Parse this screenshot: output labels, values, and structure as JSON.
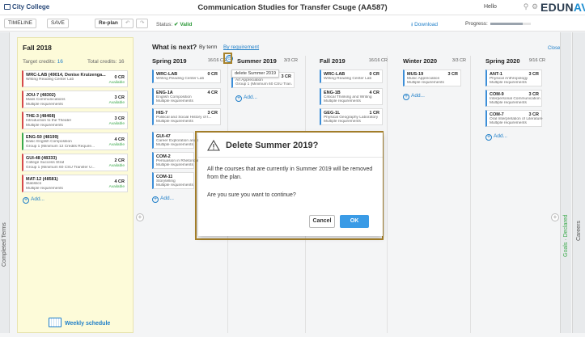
{
  "app": {
    "logo": "City College",
    "title": "Communication Studies for Transfer Csuge (AA587)",
    "hello": "Hello",
    "brand_main": "EDUN",
    "brand_accent": "AV"
  },
  "toolbar": {
    "timeline": "TIMELINE",
    "save": "SAVE",
    "replan": "Re-plan",
    "undo": "↶",
    "redo": "↷",
    "status_label": "Status:",
    "status_value": "Valid",
    "download": "Download",
    "progress_label": "Progress:",
    "progress_value": 0.8
  },
  "sidebars": {
    "completed_terms": "Completed Terms",
    "goals": "Goals · Declared",
    "careers": "Careers"
  },
  "fall": {
    "title": "Fall 2018",
    "target_label": "Target credits:",
    "target_value": "16",
    "total_label": "Total credits:",
    "total_value": "16",
    "courses": [
      {
        "code": "WRC-LAB (49014, Denise Kruizenga...",
        "desc1": "Writing Reading Center Lab",
        "desc2": "",
        "cr": "0 CR",
        "avail": "Available"
      },
      {
        "code": "JOU-7 (48302)",
        "desc1": "Mass Communications",
        "desc2": "Multiple requirements",
        "cr": "3 CR",
        "avail": "Available"
      },
      {
        "code": "THE-3 (48468)",
        "desc1": "Introduction to the Theater",
        "desc2": "Multiple requirements",
        "cr": "3 CR",
        "avail": "Available"
      },
      {
        "code": "ENG-50 (48199)",
        "desc1": "Basic English Composition",
        "desc2": "Group 1 (Minimum 12 Credits Require...",
        "cr": "4 CR",
        "avail": "Available"
      },
      {
        "code": "GUI-48 (48333)",
        "desc1": "College Success Strat",
        "desc2": "Group 1 (Minimum 60 CSU Transfer U...",
        "cr": "2 CR",
        "avail": "Available"
      },
      {
        "code": "MAT-12 (48581)",
        "desc1": "Statistics",
        "desc2": "Multiple requirements",
        "cr": "4 CR",
        "avail": "Available"
      }
    ],
    "add": "Add...",
    "weekly": "Weekly schedule"
  },
  "planner": {
    "heading": "What is next?",
    "by_term": "By term",
    "by_requirement": "By requirement",
    "close": "Close ✕",
    "add": "Add...",
    "columns": [
      {
        "title": "Spring 2019",
        "credits": "16/16 CR",
        "courses": [
          {
            "code": "WRC-LAB",
            "desc1": "Writing Reading Center Lab",
            "desc2": "",
            "cr": "0 CR"
          },
          {
            "code": "ENG-1A",
            "desc1": "English Composition",
            "desc2": "Multiple requirements",
            "cr": "4 CR"
          },
          {
            "code": "HIS-7",
            "desc1": "Political and Social History of t...",
            "desc2": "Multiple requirements",
            "cr": "3 CR"
          },
          {
            "code": "GUI-47",
            "desc1": "Career Exploration and Life",
            "desc2": "Multiple requirements",
            "cr": ""
          },
          {
            "code": "COM-2",
            "desc1": "Persuasion in Rhetorical Pr",
            "desc2": "Multiple requirements",
            "cr": ""
          },
          {
            "code": "COM-11",
            "desc1": "Storytelling",
            "desc2": "Multiple requirements",
            "cr": ""
          }
        ]
      },
      {
        "title": "Summer 2019",
        "credits": "3/3 CR",
        "courses": [
          {
            "code": "",
            "desc1": "Art Appreciation",
            "desc2": "Group 1 (Minimum 60 CSU Tran...",
            "cr": "3 CR"
          }
        ]
      },
      {
        "title": "Fall 2019",
        "credits": "16/16 CR",
        "courses": [
          {
            "code": "WRC-LAB",
            "desc1": "Writing Reading Center Lab",
            "desc2": "",
            "cr": "0 CR"
          },
          {
            "code": "ENG-1B",
            "desc1": "Critical Thinking and Writing",
            "desc2": "Multiple requirements",
            "cr": "4 CR"
          },
          {
            "code": "GEG-1L",
            "desc1": "Physical Geography Laboratory",
            "desc2": "Multiple requirements",
            "cr": "1 CR"
          }
        ]
      },
      {
        "title": "Winter 2020",
        "credits": "3/3 CR",
        "courses": [
          {
            "code": "MUS-19",
            "desc1": "Music Appreciation",
            "desc2": "Multiple requirements",
            "cr": "3 CR"
          }
        ]
      },
      {
        "title": "Spring 2020",
        "credits": "9/16 CR",
        "courses": [
          {
            "code": "ANT-1",
            "desc1": "Physical Anthropology",
            "desc2": "Multiple requirements",
            "cr": "3 CR"
          },
          {
            "code": "COM-9",
            "desc1": "Interpersonal Communication",
            "desc2": "Multiple requirements",
            "cr": "3 CR"
          },
          {
            "code": "COM-7",
            "desc1": "Oral Interpretation of Literature",
            "desc2": "Multiple requirements",
            "cr": "3 CR"
          }
        ]
      }
    ],
    "tooltip": "delete Summer 2019"
  },
  "modal": {
    "title": "Delete Summer 2019?",
    "body1": "All the courses that are currently in Summer 2019 will be removed from the plan.",
    "body2": "Are you sure you want to continue?",
    "cancel": "Cancel",
    "ok": "OK"
  }
}
